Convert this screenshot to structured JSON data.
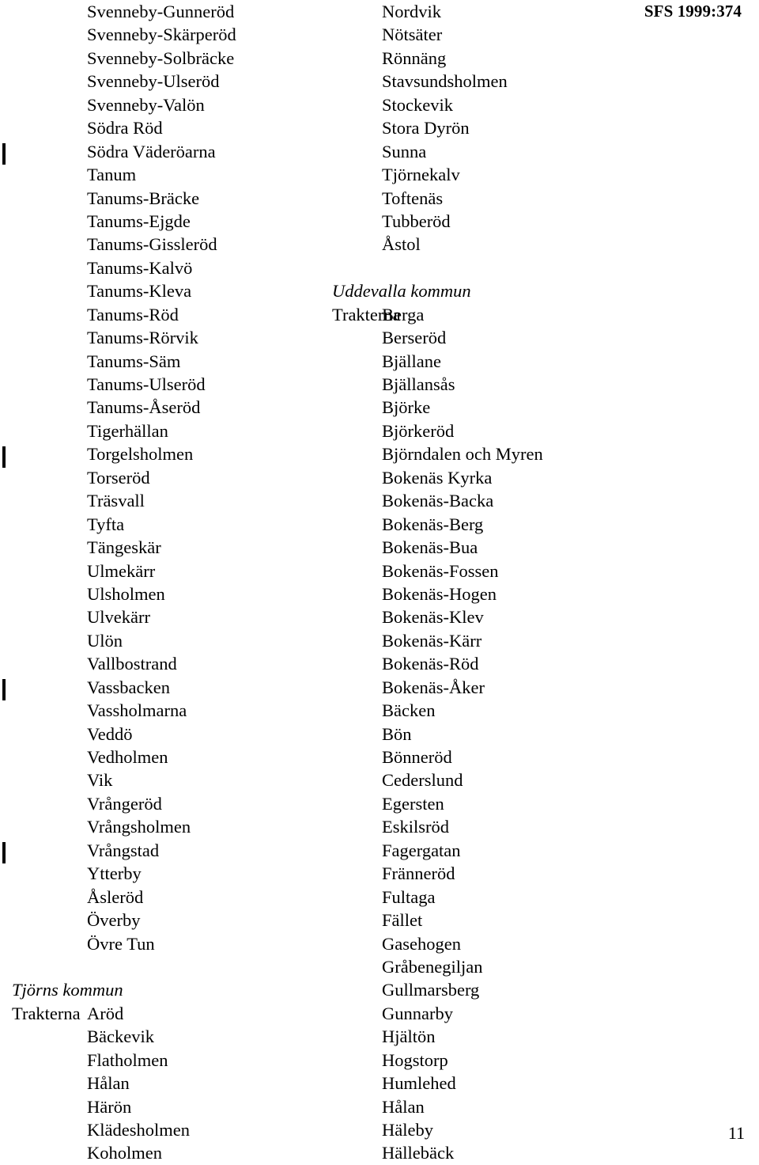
{
  "document": {
    "sfs_reference": "SFS 1999:374",
    "page_number": "11",
    "trakterna_label": "Trakterna"
  },
  "left_column": [
    {
      "type": "place",
      "name": "Svenneby-Gunneröd"
    },
    {
      "type": "place",
      "name": "Svenneby-Skärperöd"
    },
    {
      "type": "place",
      "name": "Svenneby-Solbräcke"
    },
    {
      "type": "place",
      "name": "Svenneby-Ulseröd"
    },
    {
      "type": "place",
      "name": "Svenneby-Valön"
    },
    {
      "type": "place",
      "name": "Södra Röd"
    },
    {
      "type": "place",
      "name": "Södra Väderöarna",
      "changed": true
    },
    {
      "type": "place",
      "name": "Tanum"
    },
    {
      "type": "place",
      "name": "Tanums-Bräcke"
    },
    {
      "type": "place",
      "name": "Tanums-Ejgde"
    },
    {
      "type": "place",
      "name": "Tanums-Gissleröd"
    },
    {
      "type": "place",
      "name": "Tanums-Kalvö"
    },
    {
      "type": "place",
      "name": "Tanums-Kleva"
    },
    {
      "type": "place",
      "name": "Tanums-Röd"
    },
    {
      "type": "place",
      "name": "Tanums-Rörvik"
    },
    {
      "type": "place",
      "name": "Tanums-Säm"
    },
    {
      "type": "place",
      "name": "Tanums-Ulseröd"
    },
    {
      "type": "place",
      "name": "Tanums-Åseröd"
    },
    {
      "type": "place",
      "name": "Tigerhällan"
    },
    {
      "type": "place",
      "name": "Torgelsholmen",
      "changed": true
    },
    {
      "type": "place",
      "name": "Torseröd"
    },
    {
      "type": "place",
      "name": "Träsvall"
    },
    {
      "type": "place",
      "name": "Tyfta"
    },
    {
      "type": "place",
      "name": "Tängeskär"
    },
    {
      "type": "place",
      "name": "Ulmekärr"
    },
    {
      "type": "place",
      "name": "Ulsholmen"
    },
    {
      "type": "place",
      "name": "Ulvekärr"
    },
    {
      "type": "place",
      "name": "Ulön"
    },
    {
      "type": "place",
      "name": "Vallbostrand"
    },
    {
      "type": "place",
      "name": "Vassbacken",
      "changed": true
    },
    {
      "type": "place",
      "name": "Vassholmarna"
    },
    {
      "type": "place",
      "name": "Veddö"
    },
    {
      "type": "place",
      "name": "Vedholmen"
    },
    {
      "type": "place",
      "name": "Vik"
    },
    {
      "type": "place",
      "name": "Vrångeröd"
    },
    {
      "type": "place",
      "name": "Vrångsholmen"
    },
    {
      "type": "place",
      "name": "Vrångstad",
      "changed": true
    },
    {
      "type": "place",
      "name": "Ytterby"
    },
    {
      "type": "place",
      "name": "Åsleröd"
    },
    {
      "type": "place",
      "name": "Överby"
    },
    {
      "type": "place",
      "name": "Övre Tun"
    },
    {
      "type": "spacer"
    },
    {
      "type": "heading",
      "name": "Tjörns kommun"
    },
    {
      "type": "place",
      "name": "Aröd",
      "trakterna": true
    },
    {
      "type": "place",
      "name": "Bäckevik"
    },
    {
      "type": "place",
      "name": "Flatholmen"
    },
    {
      "type": "place",
      "name": "Hålan"
    },
    {
      "type": "place",
      "name": "Härön"
    },
    {
      "type": "place",
      "name": "Klädesholmen"
    },
    {
      "type": "place",
      "name": "Koholmen"
    }
  ],
  "right_column": [
    {
      "type": "place",
      "name": "Nordvik"
    },
    {
      "type": "place",
      "name": "Nötsäter"
    },
    {
      "type": "place",
      "name": "Rönnäng"
    },
    {
      "type": "place",
      "name": "Stavsundsholmen"
    },
    {
      "type": "place",
      "name": "Stockevik"
    },
    {
      "type": "place",
      "name": "Stora Dyrön"
    },
    {
      "type": "place",
      "name": "Sunna"
    },
    {
      "type": "place",
      "name": "Tjörnekalv"
    },
    {
      "type": "place",
      "name": "Toftenäs"
    },
    {
      "type": "place",
      "name": "Tubberöd"
    },
    {
      "type": "place",
      "name": "Åstol"
    },
    {
      "type": "spacer"
    },
    {
      "type": "heading",
      "name": "Uddevalla kommun"
    },
    {
      "type": "place",
      "name": "Berga",
      "trakterna": true
    },
    {
      "type": "place",
      "name": "Berseröd"
    },
    {
      "type": "place",
      "name": "Bjällane"
    },
    {
      "type": "place",
      "name": "Bjällansås"
    },
    {
      "type": "place",
      "name": "Björke"
    },
    {
      "type": "place",
      "name": "Björkeröd"
    },
    {
      "type": "place",
      "name": "Björndalen och Myren"
    },
    {
      "type": "place",
      "name": "Bokenäs Kyrka"
    },
    {
      "type": "place",
      "name": "Bokenäs-Backa"
    },
    {
      "type": "place",
      "name": "Bokenäs-Berg"
    },
    {
      "type": "place",
      "name": "Bokenäs-Bua"
    },
    {
      "type": "place",
      "name": "Bokenäs-Fossen"
    },
    {
      "type": "place",
      "name": "Bokenäs-Hogen"
    },
    {
      "type": "place",
      "name": "Bokenäs-Klev"
    },
    {
      "type": "place",
      "name": "Bokenäs-Kärr"
    },
    {
      "type": "place",
      "name": "Bokenäs-Röd"
    },
    {
      "type": "place",
      "name": "Bokenäs-Åker"
    },
    {
      "type": "place",
      "name": "Bäcken"
    },
    {
      "type": "place",
      "name": "Bön"
    },
    {
      "type": "place",
      "name": "Bönneröd"
    },
    {
      "type": "place",
      "name": "Cederslund"
    },
    {
      "type": "place",
      "name": "Egersten"
    },
    {
      "type": "place",
      "name": "Eskilsröd"
    },
    {
      "type": "place",
      "name": "Fagergatan"
    },
    {
      "type": "place",
      "name": "Fränneröd"
    },
    {
      "type": "place",
      "name": "Fultaga"
    },
    {
      "type": "place",
      "name": "Fället"
    },
    {
      "type": "place",
      "name": "Gasehogen"
    },
    {
      "type": "place",
      "name": "Gråbenegiljan"
    },
    {
      "type": "place",
      "name": "Gullmarsberg"
    },
    {
      "type": "place",
      "name": "Gunnarby"
    },
    {
      "type": "place",
      "name": "Hjältön"
    },
    {
      "type": "place",
      "name": "Hogstorp"
    },
    {
      "type": "place",
      "name": "Humlehed"
    },
    {
      "type": "place",
      "name": "Hålan"
    },
    {
      "type": "place",
      "name": "Häleby"
    },
    {
      "type": "place",
      "name": "Hällebäck"
    }
  ]
}
